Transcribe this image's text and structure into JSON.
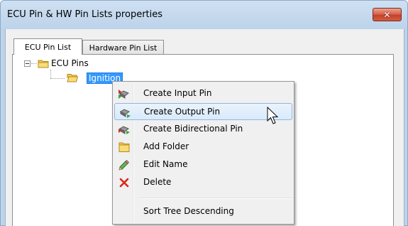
{
  "window": {
    "title": "ECU Pin & HW Pin Lists properties",
    "close_symbol": "✕"
  },
  "tabs": [
    {
      "label": "ECU Pin List",
      "active": true
    },
    {
      "label": "Hardware Pin List",
      "active": false
    }
  ],
  "tree": {
    "root": {
      "label": "ECU Pins",
      "icon": "folder-icon",
      "expanded": true
    },
    "child": {
      "label": "Ignition",
      "icon": "folder-open-icon",
      "selected": true
    }
  },
  "context_menu": {
    "items": [
      {
        "label": "Create Input Pin",
        "icon": "input-pin-icon"
      },
      {
        "label": "Create Output Pin",
        "icon": "output-pin-icon",
        "hovered": true
      },
      {
        "label": "Create Bidirectional Pin",
        "icon": "bidirectional-pin-icon"
      },
      {
        "label": "Add Folder",
        "icon": "folder-icon"
      },
      {
        "label": "Edit Name",
        "icon": "pencil-icon"
      },
      {
        "label": "Delete",
        "icon": "delete-x-icon"
      },
      {
        "label": "Sort Tree Descending",
        "icon": ""
      }
    ]
  },
  "colors": {
    "selection": "#3399ff",
    "menu_hover_border": "#8fb6e3",
    "delete_red": "#d9291c",
    "folder_yellow": "#f3c84a"
  }
}
